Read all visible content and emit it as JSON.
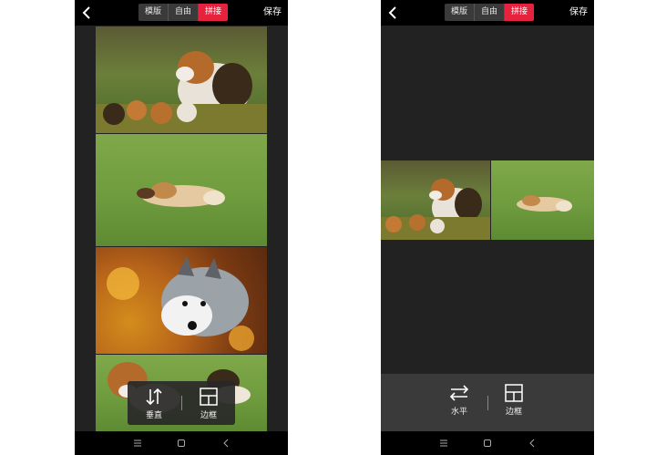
{
  "left_screen": {
    "header": {
      "tabs": [
        {
          "label": "模版",
          "active": false
        },
        {
          "label": "自由",
          "active": false
        },
        {
          "label": "拼接",
          "active": true
        }
      ],
      "save_label": "保存"
    },
    "tools": [
      {
        "label": "垂直",
        "icon": "vertical-swap-icon"
      },
      {
        "label": "边框",
        "icon": "frame-layout-icon"
      }
    ]
  },
  "right_screen": {
    "header": {
      "tabs": [
        {
          "label": "模版",
          "active": false
        },
        {
          "label": "自由",
          "active": false
        },
        {
          "label": "拼接",
          "active": true
        }
      ],
      "save_label": "保存"
    },
    "tools": [
      {
        "label": "水平",
        "icon": "horizontal-swap-icon"
      },
      {
        "label": "边框",
        "icon": "frame-layout-icon"
      }
    ]
  },
  "colors": {
    "accent": "#e6223f",
    "topbar_bg": "#000000",
    "canvas_bg": "#222222"
  }
}
